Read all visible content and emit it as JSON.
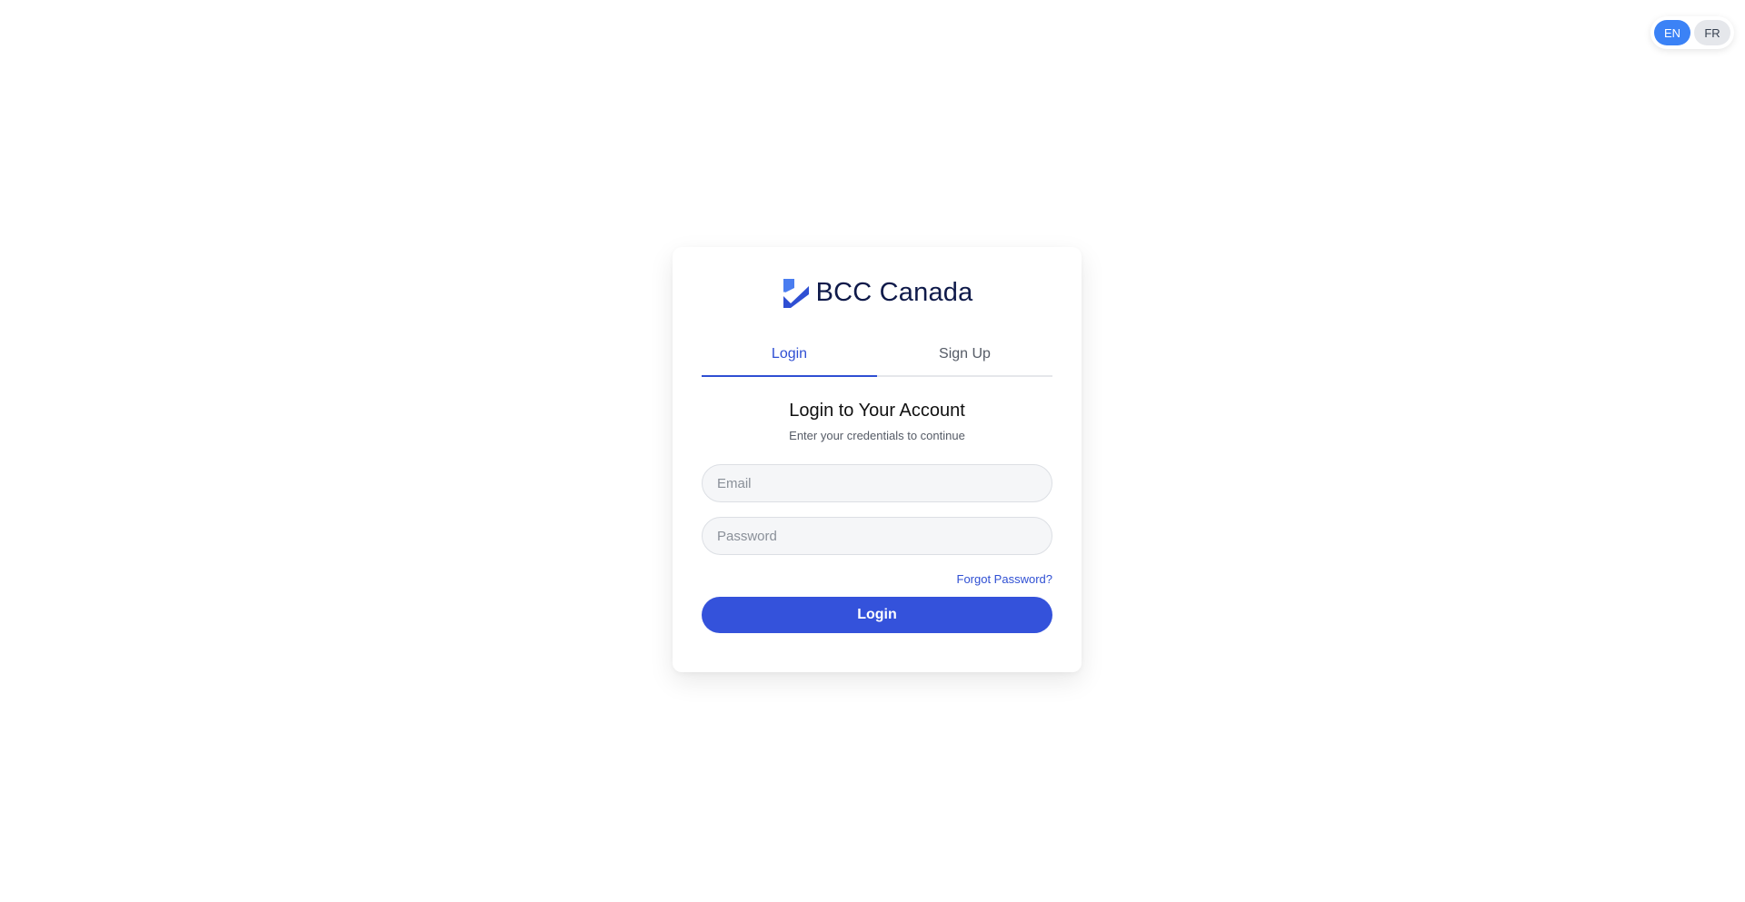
{
  "language_switcher": {
    "options": [
      {
        "label": "EN",
        "active": true
      },
      {
        "label": "FR",
        "active": false
      }
    ]
  },
  "brand": {
    "name": "BCC Canada",
    "logo_icon": "checkmark-logo-icon",
    "colors": {
      "primary": "#3452db",
      "logo_light": "#3b82f6",
      "logo_dark": "#2f4fd3",
      "text_dark": "#0f1a4a"
    }
  },
  "tabs": [
    {
      "label": "Login",
      "active": true
    },
    {
      "label": "Sign Up",
      "active": false
    }
  ],
  "form": {
    "heading": "Login to Your Account",
    "subheading": "Enter your credentials to continue",
    "email_placeholder": "Email",
    "email_value": "",
    "password_placeholder": "Password",
    "password_value": "",
    "forgot_password": "Forgot Password?",
    "submit_label": "Login"
  }
}
